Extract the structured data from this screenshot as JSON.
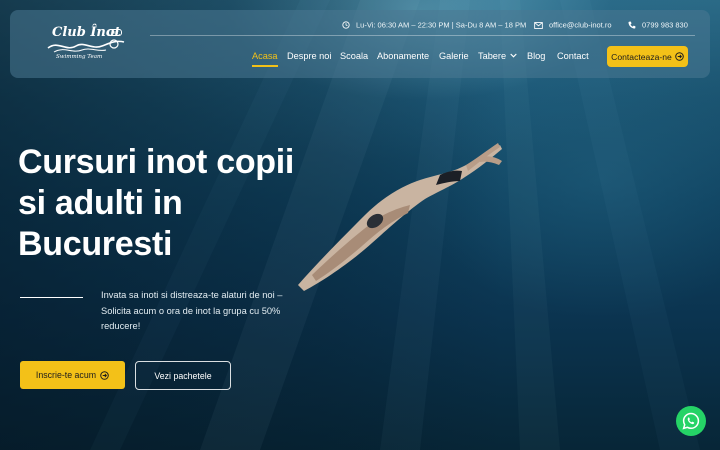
{
  "brand": {
    "logo_text": "Club Înot",
    "logo_est": "EST",
    "logo_subtitle": "Swimming Team"
  },
  "topbar": {
    "hours": "Lu-Vi: 06:30 AM – 22:30 PM | Sa-Du 8 AM – 18 PM",
    "email": "office@club-inot.ro",
    "phone": "0799 983 830"
  },
  "nav": {
    "items": [
      {
        "label": "Acasa"
      },
      {
        "label": "Despre noi"
      },
      {
        "label": "Scoala"
      },
      {
        "label": "Abonamente"
      },
      {
        "label": "Galerie"
      },
      {
        "label": "Tabere"
      },
      {
        "label": "Blog"
      },
      {
        "label": "Contact"
      }
    ],
    "active": "Acasa",
    "cta_label": "Contacteaza-ne"
  },
  "hero": {
    "title_line1": "Cursuri inot copii",
    "title_line2": "si adulti in",
    "title_line3": "Bucuresti",
    "description": "Invata sa inoti si distreaza-te alaturi de noi – Solicita acum o ora de inot la grupa cu 50% reducere!",
    "primary_button": "Inscrie-te acum",
    "secondary_button": "Vezi pachetele"
  },
  "icons": {
    "clock": "clock-icon",
    "email": "email-icon",
    "phone": "phone-icon",
    "arrow": "arrow-circle-right-icon",
    "chevron": "chevron-down-icon",
    "whatsapp": "whatsapp-icon"
  },
  "colors": {
    "accent": "#f3c118",
    "whatsapp": "#25d366",
    "water_dark": "#0b3450",
    "water_light": "#2b6a86"
  }
}
